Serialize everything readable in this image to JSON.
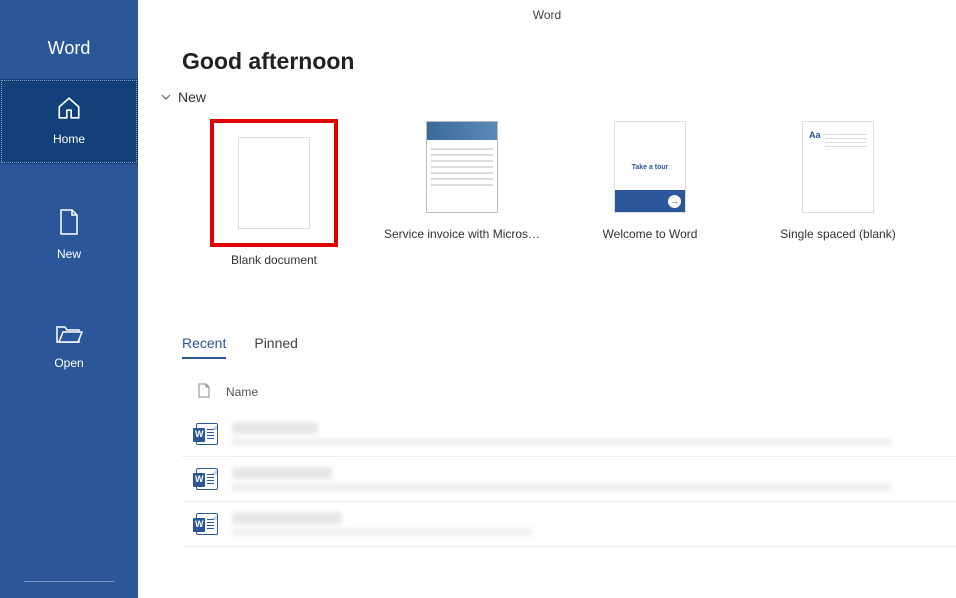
{
  "titlebar": {
    "app_name": "Word"
  },
  "sidebar": {
    "title": "Word",
    "items": [
      {
        "label": "Home",
        "icon": "home-icon",
        "selected": true
      },
      {
        "label": "New",
        "icon": "new-doc-icon",
        "selected": false
      },
      {
        "label": "Open",
        "icon": "folder-open-icon",
        "selected": false
      }
    ]
  },
  "main": {
    "greeting": "Good afternoon",
    "new_section": {
      "label": "New",
      "templates": [
        {
          "label": "Blank document",
          "highlighted": true
        },
        {
          "label": "Service invoice with Micros…"
        },
        {
          "label": "Welcome to Word",
          "tour_text": "Take a tour"
        },
        {
          "label": "Single spaced (blank)",
          "aa": "Aa"
        }
      ]
    },
    "tabs": [
      {
        "label": "Recent",
        "active": true
      },
      {
        "label": "Pinned",
        "active": false
      }
    ],
    "file_table": {
      "columns": {
        "name": "Name"
      },
      "rows": [
        {
          "blurred": true
        },
        {
          "blurred": true
        },
        {
          "blurred": true
        }
      ]
    }
  }
}
